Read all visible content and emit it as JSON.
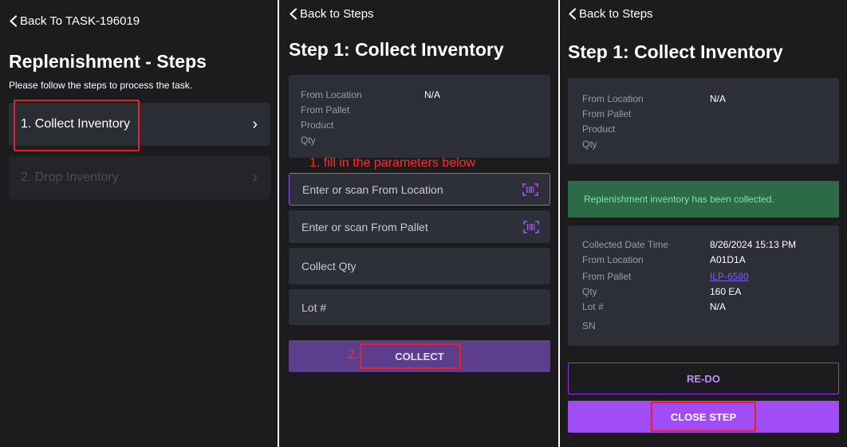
{
  "panel1": {
    "back_label": "Back To TASK-196019",
    "title": "Replenishment - Steps",
    "subtitle": "Please follow the steps to process the task.",
    "steps": [
      {
        "label": "1. Collect Inventory",
        "chevron": "›",
        "state": "active"
      },
      {
        "label": "2. Drop Inventory",
        "chevron": "›",
        "state": "disabled"
      }
    ]
  },
  "panel2": {
    "back_label": "Back to Steps",
    "title": "Step 1: Collect Inventory",
    "info": {
      "labels": [
        "From Location",
        "From Pallet",
        "Product",
        "Qty"
      ],
      "from_location_value": "N/A"
    },
    "annotation_1": "1. fill in the parameters below",
    "inputs": {
      "from_location_placeholder": "Enter or scan From Location",
      "from_pallet_placeholder": "Enter or scan From Pallet",
      "collect_qty_placeholder": "Collect Qty",
      "lot_placeholder": "Lot #"
    },
    "annotation_2": "2.",
    "collect_label": "COLLECT"
  },
  "panel3": {
    "back_label": "Back to Steps",
    "title": "Step 1: Collect Inventory",
    "info": {
      "labels": [
        "From Location",
        "From Pallet",
        "Product",
        "Qty"
      ],
      "from_location_value": "N/A"
    },
    "success_message": "Replenishment inventory has been collected.",
    "details": {
      "collected_date_label": "Collected Date Time",
      "collected_date_value": "8/26/2024 15:13 PM",
      "from_location_label": "From Location",
      "from_location_value": "A01D1A",
      "from_pallet_label": "From Pallet",
      "from_pallet_value": "ILP-6580",
      "qty_label": "Qty",
      "qty_value": "160 EA",
      "lot_label": "Lot #",
      "lot_value": "N/A",
      "sn_label": "SN"
    },
    "redo_label": "RE-DO",
    "close_label": "CLOSE STEP"
  },
  "colors": {
    "background": "#1c1c1e",
    "card": "#2c2f37",
    "accent_purple": "#a14df5",
    "annotation_red": "#e8202a",
    "success_green": "#2d6b48"
  },
  "icons": [
    "chevron-left-icon",
    "chevron-right-icon",
    "barcode-scan-icon"
  ]
}
